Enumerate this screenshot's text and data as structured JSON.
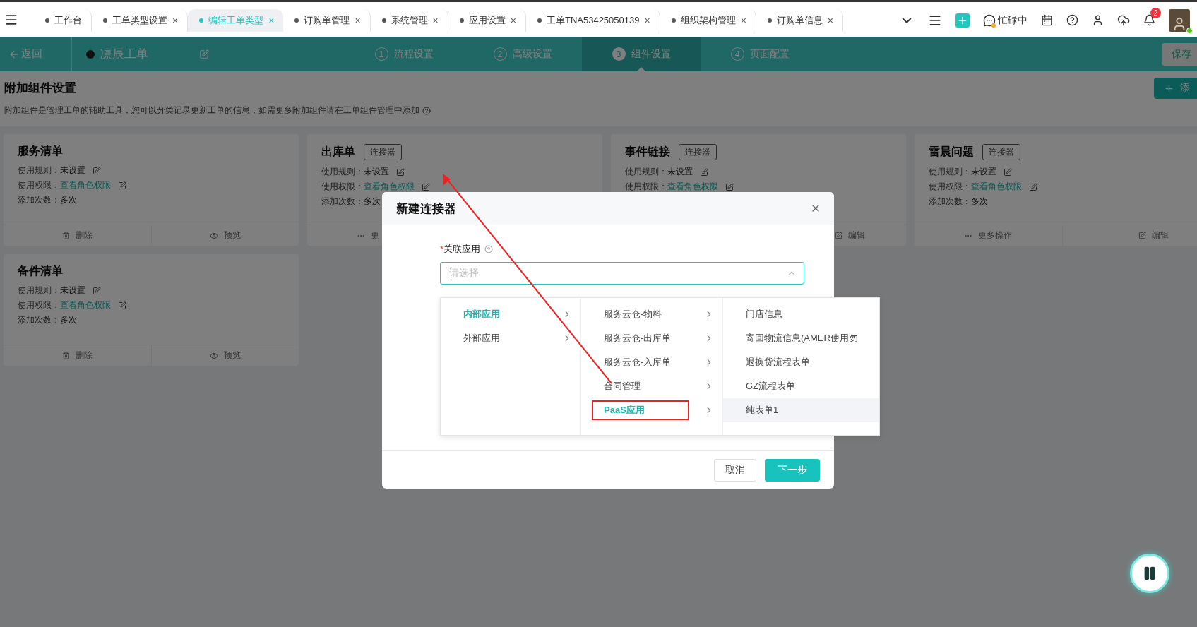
{
  "tabs": [
    {
      "label": "工作台",
      "selected": false,
      "closable": false
    },
    {
      "label": "工单类型设置",
      "selected": false,
      "closable": true
    },
    {
      "label": "编辑工单类型",
      "selected": true,
      "closable": true
    },
    {
      "label": "订购单管理",
      "selected": false,
      "closable": true
    },
    {
      "label": "系统管理",
      "selected": false,
      "closable": true
    },
    {
      "label": "应用设置",
      "selected": false,
      "closable": true
    },
    {
      "label": "工单TNA53425050139",
      "selected": false,
      "closable": true
    },
    {
      "label": "组织架构管理",
      "selected": false,
      "closable": true
    },
    {
      "label": "订购单信息",
      "selected": false,
      "closable": true
    }
  ],
  "tab_close": "×",
  "status": {
    "label": "忙碌中"
  },
  "notifications": {
    "count": "2"
  },
  "header": {
    "back": "返回",
    "title": "凛辰工单",
    "save": "保存",
    "steps": [
      {
        "number": "1",
        "label": "流程设置",
        "selected": false
      },
      {
        "number": "2",
        "label": "高级设置",
        "selected": false
      },
      {
        "number": "3",
        "label": "组件设置",
        "selected": true
      },
      {
        "number": "4",
        "label": "页面配置",
        "selected": false
      }
    ]
  },
  "section": {
    "title": "附加组件设置",
    "description": "附加组件是管理工单的辅助工具，您可以分类记录更新工单的信息，如需更多附加组件请在工单组件管理中添加",
    "add_button": "添"
  },
  "cards": [
    {
      "title": "服务清单",
      "rows": [
        {
          "label": "使用规则：",
          "value": "未设置",
          "kind": "text"
        },
        {
          "label": "使用权限：",
          "value": "查看角色权限",
          "kind": "link"
        },
        {
          "label": "添加次数：",
          "value": "多次",
          "kind": "plain"
        }
      ],
      "actions": [
        {
          "kind": "delete",
          "label": "删除"
        },
        {
          "kind": "preview",
          "label": "预览"
        }
      ]
    },
    {
      "title": "出库单",
      "badge": "连接器",
      "rows": [
        {
          "label": "使用规则：",
          "value": "未设置",
          "kind": "text"
        },
        {
          "label": "使用权限：",
          "value": "查看角色权限",
          "kind": "link"
        },
        {
          "label": "添加次数：",
          "value": "多次",
          "kind": "plain"
        }
      ],
      "actions": [
        {
          "kind": "more",
          "label": "更"
        }
      ]
    },
    {
      "title": "事件链接",
      "badge": "连接器",
      "rows": [
        {
          "label": "使用规则：",
          "value": "未设置",
          "kind": "text"
        },
        {
          "label": "使用权限：",
          "value": "查看角色权限",
          "kind": "link"
        }
      ],
      "actions": [
        {
          "kind": "edit",
          "label": "编辑"
        }
      ]
    },
    {
      "title": "雷晨问题",
      "badge": "连接器",
      "rows": [
        {
          "label": "使用规则：",
          "value": "未设置",
          "kind": "text"
        },
        {
          "label": "使用权限：",
          "value": "查看角色权限",
          "kind": "link"
        },
        {
          "label": "添加次数：",
          "value": "多次",
          "kind": "plain"
        }
      ],
      "actions": [
        {
          "kind": "more",
          "label": "更多操作"
        },
        {
          "kind": "edit",
          "label": "编辑"
        }
      ]
    },
    {
      "title": "备件清单",
      "rows": [
        {
          "label": "使用规则：",
          "value": "未设置",
          "kind": "text"
        },
        {
          "label": "使用权限：",
          "value": "查看角色权限",
          "kind": "link"
        },
        {
          "label": "添加次数：",
          "value": "多次",
          "kind": "plain"
        }
      ],
      "actions": [
        {
          "kind": "delete",
          "label": "删除"
        },
        {
          "kind": "preview",
          "label": "预览"
        }
      ]
    }
  ],
  "dialog": {
    "title": "新建连接器",
    "field_label": "关联应用",
    "required_mark": "*",
    "placeholder": "请选择",
    "cancel": "取消",
    "next": "下一步",
    "cascader": [
      {
        "items": [
          {
            "label": "内部应用",
            "selected": true,
            "has_children": true
          },
          {
            "label": "外部应用",
            "selected": false,
            "has_children": true
          }
        ]
      },
      {
        "items": [
          {
            "label": "服务云仓-物料",
            "selected": false,
            "has_children": true
          },
          {
            "label": "服务云仓-出库单",
            "selected": false,
            "has_children": true
          },
          {
            "label": "服务云仓-入库单",
            "selected": false,
            "has_children": true
          },
          {
            "label": "合同管理",
            "selected": false,
            "has_children": true
          },
          {
            "label": "PaaS应用",
            "selected": true,
            "has_children": true,
            "highlighted": true
          }
        ]
      },
      {
        "items": [
          {
            "label": "门店信息",
            "selected": false,
            "hovered": false
          },
          {
            "label": "寄回物流信息(AMER使用勿",
            "selected": false,
            "hovered": false
          },
          {
            "label": "退换货流程表单",
            "selected": false,
            "hovered": false
          },
          {
            "label": "GZ流程表单",
            "selected": false,
            "hovered": false
          },
          {
            "label": "纯表单1",
            "selected": false,
            "hovered": true
          }
        ]
      }
    ]
  }
}
